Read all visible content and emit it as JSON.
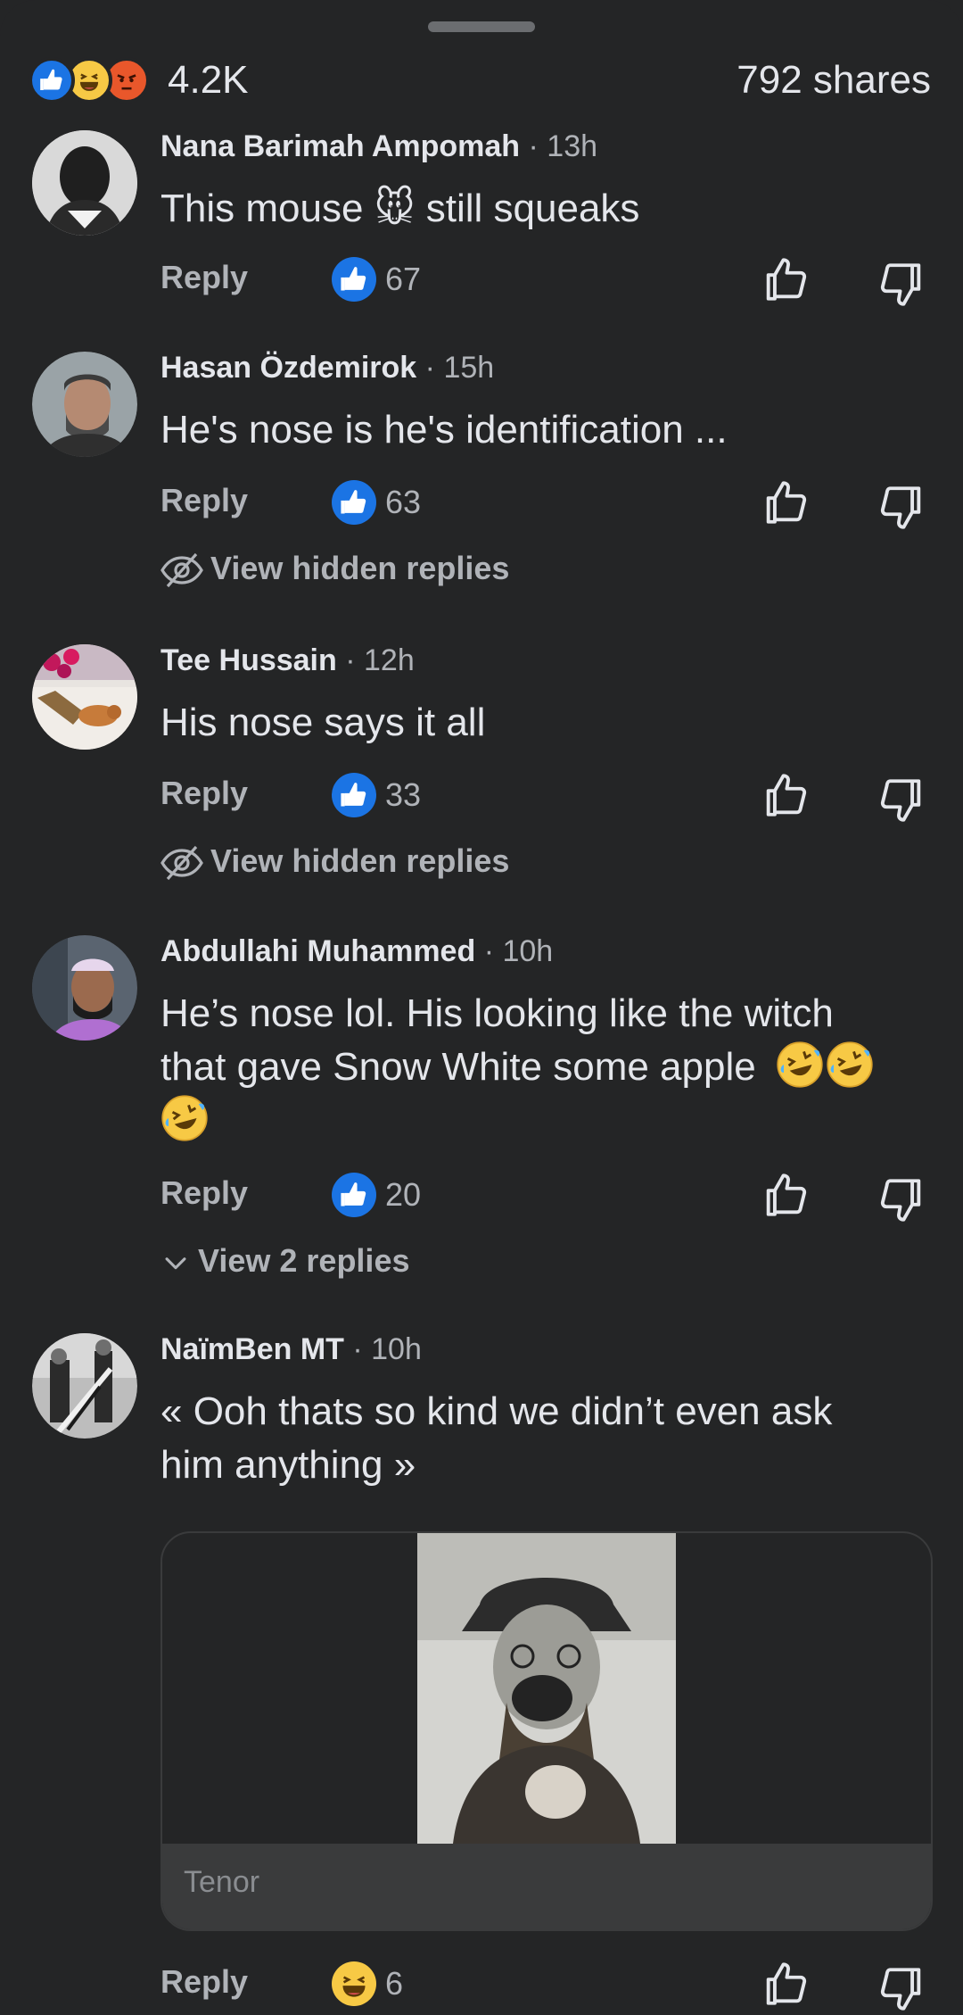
{
  "reactions_bar": {
    "icons": [
      "like-reaction",
      "haha-reaction",
      "angry-reaction"
    ],
    "count": "4.2K",
    "shares": "792 shares"
  },
  "comments": [
    {
      "author": "Nana Barimah Ampomah",
      "time": "· 13h",
      "text_before": "This mouse ",
      "emoji": "🐭",
      "text_after": " still squeaks",
      "reply_label": "Reply",
      "reaction_count": "67"
    },
    {
      "author": "Hasan Özdemirok",
      "time": "· 15h",
      "text": "He's nose is he's identification ...",
      "reply_label": "Reply",
      "reaction_count": "63",
      "sub_link": "View hidden replies"
    },
    {
      "author": "Tee Hussain",
      "time": "· 12h",
      "text": "His nose says it all",
      "reply_label": "Reply",
      "reaction_count": "33",
      "sub_link": "View hidden replies"
    },
    {
      "author": "Abdullahi Muhammed",
      "time": "· 10h",
      "text_line1": "He’s nose lol.  His looking like the witch",
      "text_line2": "that gave Snow White some apple",
      "reply_label": "Reply",
      "reaction_count": "20",
      "sub_link": "View 2 replies"
    },
    {
      "author": "NaïmBen MT",
      "time": "· 10h",
      "text_line1": "« Ooh thats so kind we didn’t even ask",
      "text_line2": "him anything »",
      "gif_source": "Tenor",
      "reply_label": "Reply",
      "reaction_count": "6"
    }
  ],
  "colors": {
    "background": "#242526",
    "primary_text": "#e4e6eb",
    "secondary_text": "#b0b3b8",
    "like_blue": "#1b74e4"
  }
}
